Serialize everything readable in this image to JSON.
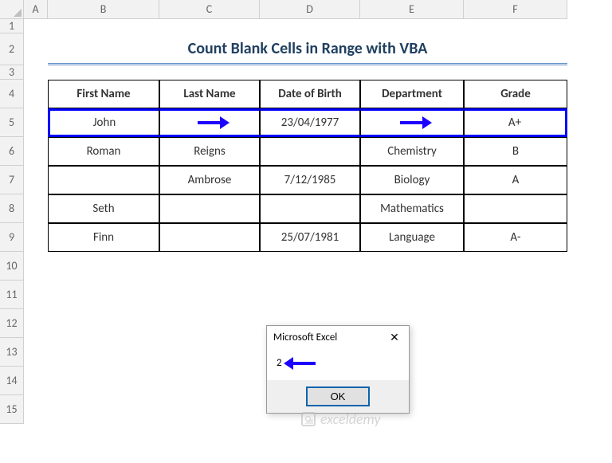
{
  "columns": [
    "A",
    "B",
    "C",
    "D",
    "E",
    "F"
  ],
  "rows": [
    "1",
    "2",
    "3",
    "4",
    "5",
    "6",
    "7",
    "8",
    "9",
    "10",
    "11",
    "12",
    "13",
    "14",
    "15"
  ],
  "title": "Count Blank Cells in Range with VBA",
  "table": {
    "headers": [
      "First Name",
      "Last Name",
      "Date of Birth",
      "Department",
      "Grade"
    ],
    "data": [
      [
        "John",
        "",
        "23/04/1977",
        "",
        "A+"
      ],
      [
        "Roman",
        "Reigns",
        "",
        "Chemistry",
        "B"
      ],
      [
        "",
        "Ambrose",
        "7/12/1985",
        "Biology",
        "A"
      ],
      [
        "Seth",
        "",
        "",
        "Mathematics",
        ""
      ],
      [
        "Finn",
        "",
        "25/07/1981",
        "Language",
        "A-"
      ]
    ]
  },
  "highlight_row_index": 0,
  "msgbox": {
    "title": "Microsoft Excel",
    "value": "2",
    "ok": "OK"
  },
  "watermark": "exceldemy",
  "chart_data": {
    "type": "table",
    "title": "Count Blank Cells in Range with VBA",
    "columns": [
      "First Name",
      "Last Name",
      "Date of Birth",
      "Department",
      "Grade"
    ],
    "rows": [
      {
        "First Name": "John",
        "Last Name": "",
        "Date of Birth": "23/04/1977",
        "Department": "",
        "Grade": "A+"
      },
      {
        "First Name": "Roman",
        "Last Name": "Reigns",
        "Date of Birth": "",
        "Department": "Chemistry",
        "Grade": "B"
      },
      {
        "First Name": "",
        "Last Name": "Ambrose",
        "Date of Birth": "7/12/1985",
        "Department": "Biology",
        "Grade": "A"
      },
      {
        "First Name": "Seth",
        "Last Name": "",
        "Date of Birth": "",
        "Department": "Mathematics",
        "Grade": ""
      },
      {
        "First Name": "Finn",
        "Last Name": "",
        "Date of Birth": "25/07/1981",
        "Department": "Language",
        "Grade": "A-"
      }
    ],
    "highlighted_row": 1,
    "blank_count_in_highlighted_row": 2
  }
}
